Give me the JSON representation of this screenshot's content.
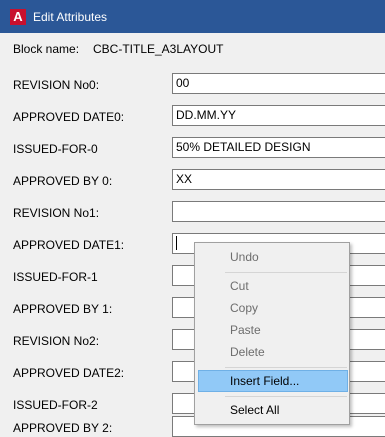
{
  "window": {
    "title": "Edit Attributes",
    "icon": "autocad-icon",
    "icon_letter": "A"
  },
  "block": {
    "label": "Block name:",
    "value": "CBC-TITLE_A3LAYOUT"
  },
  "attributes": [
    {
      "label": "REVISION No0:",
      "value": "00"
    },
    {
      "label": "APPROVED DATE0:",
      "value": "DD.MM.YY"
    },
    {
      "label": "ISSUED-FOR-0",
      "value": "50% DETAILED DESIGN"
    },
    {
      "label": "APPROVED BY 0:",
      "value": "XX"
    },
    {
      "label": "REVISION No1:",
      "value": ""
    },
    {
      "label": "APPROVED DATE1:",
      "value": ""
    },
    {
      "label": "ISSUED-FOR-1",
      "value": ""
    },
    {
      "label": "APPROVED BY 1:",
      "value": ""
    },
    {
      "label": "REVISION No2:",
      "value": ""
    },
    {
      "label": "APPROVED DATE2:",
      "value": ""
    },
    {
      "label": "ISSUED-FOR-2",
      "value": ""
    },
    {
      "label": "APPROVED BY 2:",
      "value": ""
    }
  ],
  "context_menu": {
    "items": [
      {
        "label": "Undo",
        "enabled": false
      },
      {
        "label": "Cut",
        "enabled": false
      },
      {
        "label": "Copy",
        "enabled": false
      },
      {
        "label": "Paste",
        "enabled": false
      },
      {
        "label": "Delete",
        "enabled": false
      },
      {
        "label": "Insert Field...",
        "enabled": true,
        "highlighted": true
      },
      {
        "label": "Select All",
        "enabled": true
      }
    ]
  },
  "colors": {
    "titlebar": "#2b5797",
    "highlight": "#91c9f7",
    "icon": "#c8102e"
  }
}
